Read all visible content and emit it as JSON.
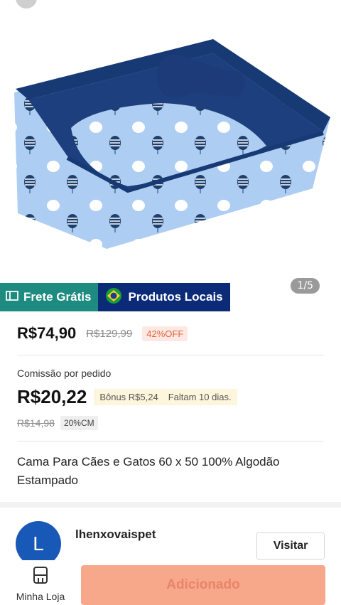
{
  "gallery": {
    "counter": "1/5"
  },
  "badges": {
    "frete_label": "Frete Grátis",
    "local_label": "Produtos Locais"
  },
  "pricing": {
    "price": "R$74,90",
    "old_price": "R$129,99",
    "discount": "42%OFF"
  },
  "commission": {
    "label": "Comissão por pedido",
    "value": "R$20,22",
    "bonus": "Bônus  R$5,24",
    "days_left": "Faltam 10 dias.",
    "old_value": "R$14,98",
    "rate": "20%CM"
  },
  "product": {
    "title": "Cama Para Cães e Gatos 60 x 50 100% Algodão Estampado"
  },
  "store": {
    "avatar_letter": "L",
    "name": "lhenxovaispet",
    "visit_label": "Visitar"
  },
  "bottom": {
    "my_shop_label": "Minha Loja",
    "add_label": "Adicionado"
  },
  "colors": {
    "frete_bg": "#1e8b80",
    "local_bg": "#0b2a78",
    "add_button": "#f7a88a",
    "avatar": "#1859b8"
  },
  "icons": [
    "back-icon",
    "frete-icon",
    "brazil-flag-icon",
    "shop-icon"
  ]
}
